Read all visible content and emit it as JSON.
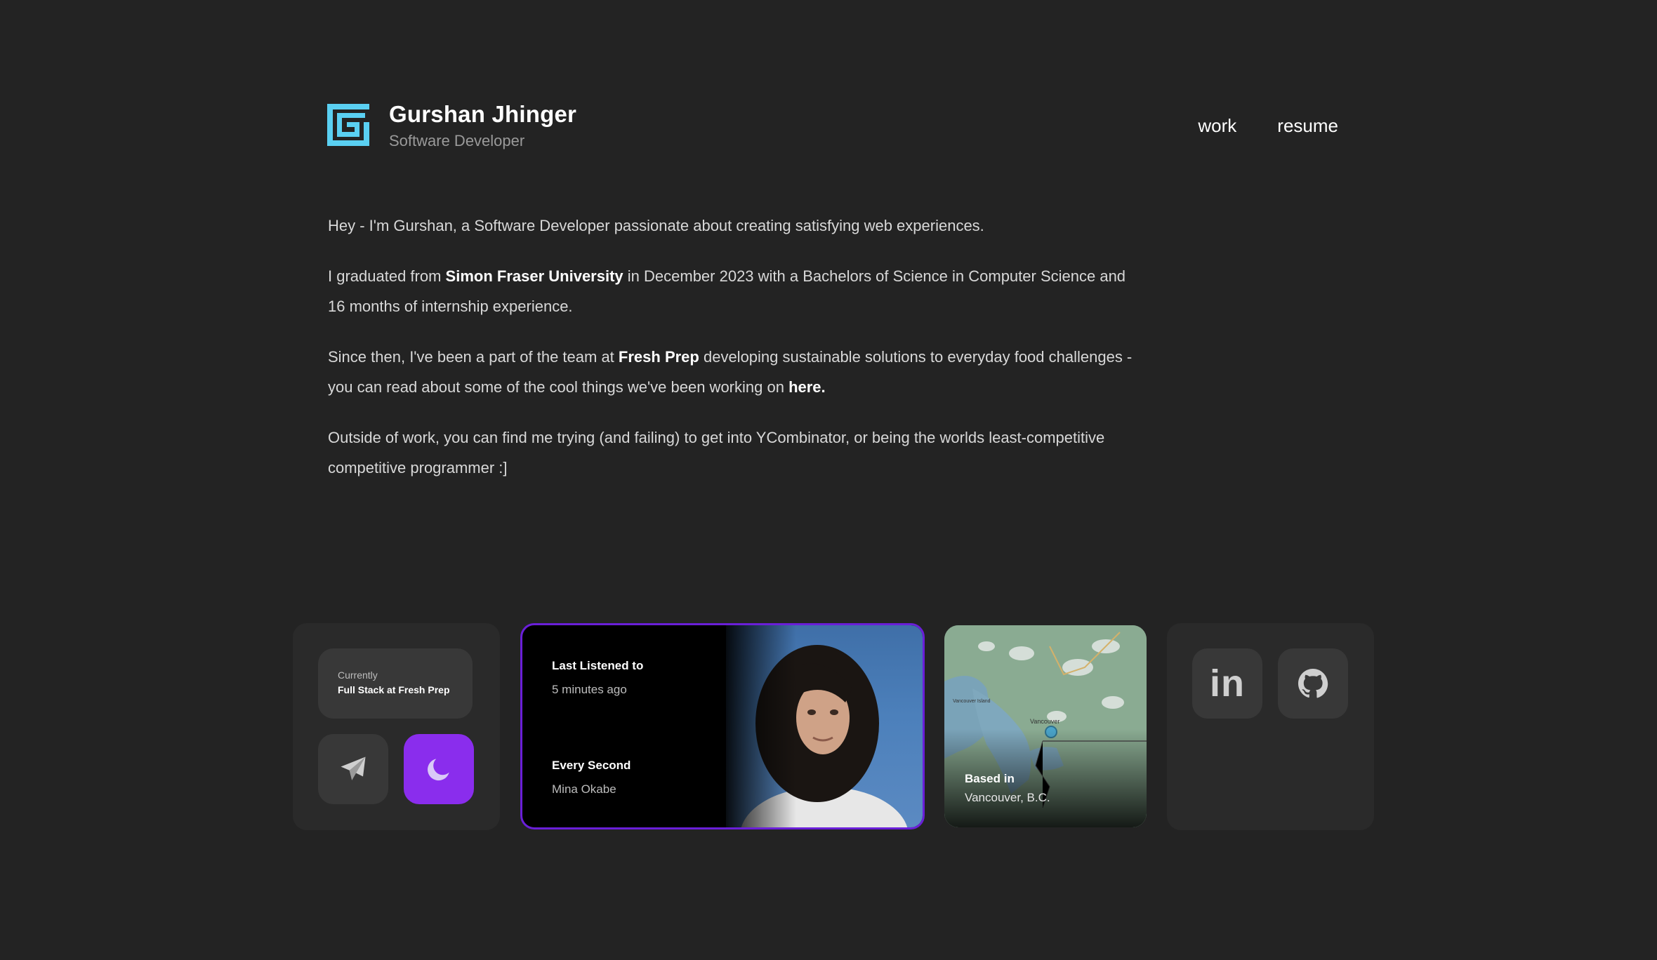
{
  "header": {
    "name": "Gurshan Jhinger",
    "role": "Software Developer",
    "nav": [
      "work",
      "resume"
    ],
    "logo_color": "#5ad0f2"
  },
  "bio": {
    "p1": "Hey - I'm Gurshan, a Software Developer passionate about creating satisfying web experiences.",
    "p2_before": "I graduated from ",
    "p2_bold": "Simon Fraser University",
    "p2_after": " in December 2023 with a Bachelors of Science in Computer Science and 16 months of internship experience.",
    "p3_before": "Since then, I've been a part of the team at ",
    "p3_bold": "Fresh Prep",
    "p3_middle": " developing sustainable solutions to everyday food challenges - you can read about some of the cool things we've been working on ",
    "p3_link": "here.",
    "p4": "Outside of work, you can find me trying (and failing) to get into YCombinator, or being the worlds least-competitive competitive programmer :]"
  },
  "status_card": {
    "label": "Currently",
    "value": "Full Stack at Fresh Prep",
    "send_icon": "paper-plane-icon",
    "theme_icon": "moon-icon",
    "theme_color": "#8a2ded"
  },
  "music_card": {
    "heading": "Last Listened to",
    "time": "5 minutes ago",
    "track": "Every Second",
    "artist": "Mina Okabe",
    "border_color": "#6a1fd8"
  },
  "location_card": {
    "label": "Based in",
    "value": "Vancouver, B.C.",
    "map_city": "Vancouver",
    "map_island": "Vancouver Island"
  },
  "social_card": {
    "linkedin": "in",
    "github_icon": "github-icon"
  }
}
